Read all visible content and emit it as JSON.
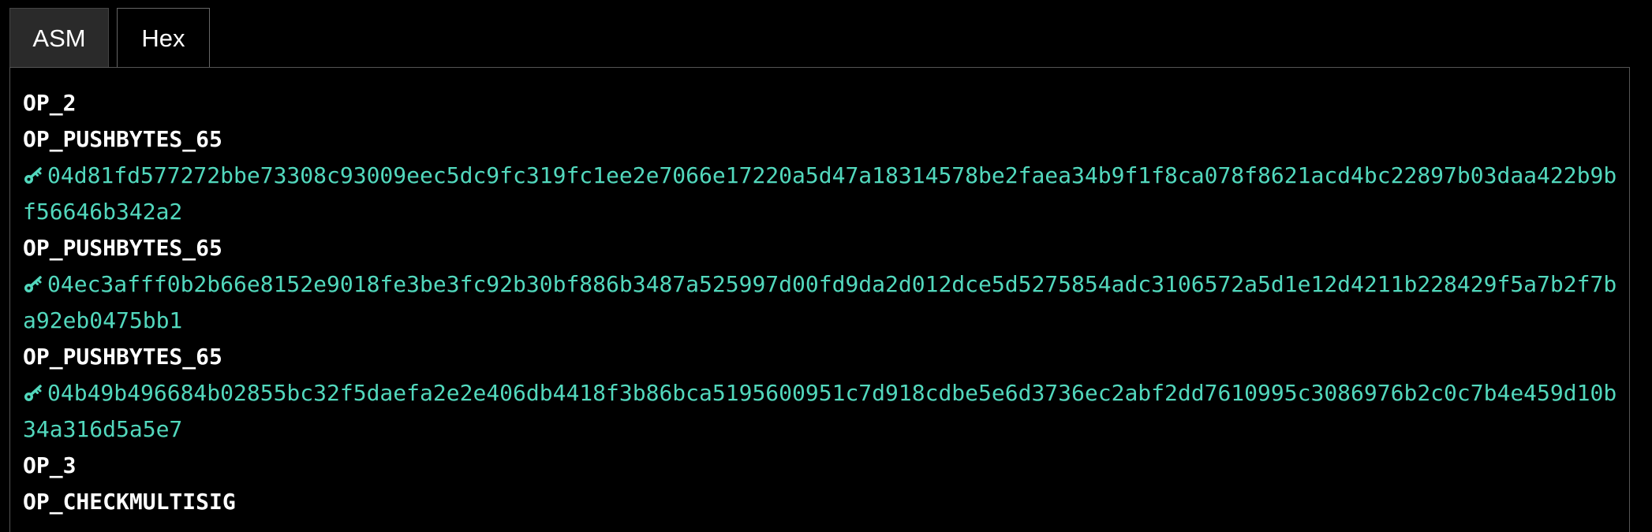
{
  "tabs": {
    "asm_label": "ASM",
    "hex_label": "Hex"
  },
  "script": {
    "op_2": "OP_2",
    "push_1": "OP_PUSHBYTES_65",
    "pubkey_1": "04d81fd577272bbe73308c93009eec5dc9fc319fc1ee2e7066e17220a5d47a18314578be2faea34b9f1f8ca078f8621acd4bc22897b03daa422b9bf56646b342a2",
    "push_2": "OP_PUSHBYTES_65",
    "pubkey_2": "04ec3afff0b2b66e8152e9018fe3be3fc92b30bf886b3487a525997d00fd9da2d012dce5d5275854adc3106572a5d1e12d4211b228429f5a7b2f7ba92eb0475bb1",
    "push_3": "OP_PUSHBYTES_65",
    "pubkey_3": "04b49b496684b02855bc32f5daefa2e2e406db4418f3b86bca5195600951c7d918cdbe5e6d3736ec2abf2dd7610995c3086976b2c0c7b4e459d10b34a316d5a5e7",
    "op_3": "OP_3",
    "op_checkmultisig": "OP_CHECKMULTISIG"
  },
  "icons": {
    "pubkey": "key-icon"
  },
  "colors": {
    "pubkey_text": "#52d8bd",
    "opcode_text": "#ffffff",
    "background": "#000000"
  }
}
